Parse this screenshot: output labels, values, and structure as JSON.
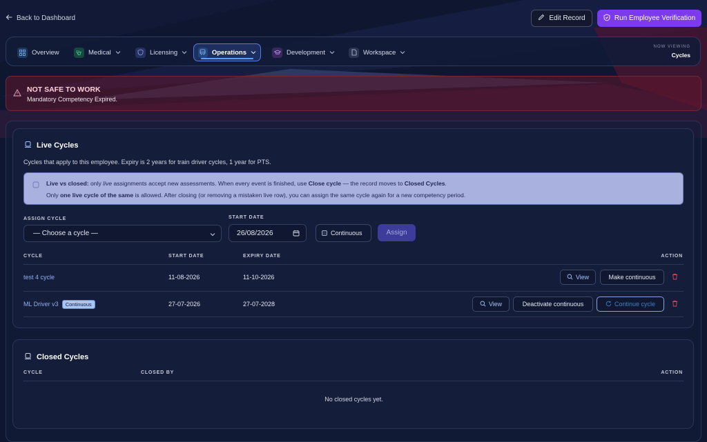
{
  "header": {
    "back_label": "Back to Dashboard",
    "edit_label": "Edit Record",
    "verify_label": "Run Employee Verification"
  },
  "nav": {
    "items": [
      {
        "label": "Overview",
        "icon": "grid-icon"
      },
      {
        "label": "Medical",
        "icon": "stethoscope-icon"
      },
      {
        "label": "Licensing",
        "icon": "shield-icon"
      },
      {
        "label": "Operations",
        "icon": "train-icon"
      },
      {
        "label": "Development",
        "icon": "graduation-cap-icon"
      },
      {
        "label": "Workspace",
        "icon": "file-icon"
      }
    ],
    "active": "Operations",
    "now_viewing_label": "NOW VIEWING",
    "now_viewing_value": "Cycles"
  },
  "alert": {
    "title": "NOT SAFE TO WORK",
    "message": "Mandatory Competency Expired."
  },
  "live": {
    "title": "Live Cycles",
    "description": "Cycles that apply to this employee. Expiry is 2 years for train driver cycles, 1 year for PTS.",
    "info_line1_parts": [
      "Live vs closed:",
      " only ",
      "live",
      " assignments accept new assessments. When every event is finished, use ",
      "Close cycle",
      " — the record moves to ",
      "Closed Cycles",
      "."
    ],
    "info_line2_parts": [
      "Only ",
      "one live cycle of the same",
      " is allowed. After closing (or removing a mistaken live row), you can assign the same cycle again for a new competency period."
    ],
    "assign_cycle_label": "ASSIGN CYCLE",
    "select_value": "— Choose a cycle —",
    "start_date_label": "START DATE",
    "start_date_value": "26/08/2026",
    "continuous_label": "Continuous",
    "assign_label": "Assign",
    "columns": [
      "CYCLE",
      "START DATE",
      "EXPIRY DATE",
      "ACTION"
    ],
    "rows": [
      {
        "cycle": "test 4 cycle",
        "badge": "",
        "start": "11-08-2026",
        "expiry": "11-10-2026",
        "actions": [
          "View",
          "Make continuous"
        ]
      },
      {
        "cycle": "ML Driver v3",
        "badge": "Continuous",
        "start": "27-07-2026",
        "expiry": "27-07-2028",
        "actions": [
          "View",
          "Deactivate continuous",
          "Continue cycle"
        ]
      }
    ]
  },
  "closed": {
    "title": "Closed Cycles",
    "columns": [
      "CYCLE",
      "CLOSED BY",
      "ACTION"
    ],
    "empty": "No closed cycles yet."
  },
  "colors": {
    "accent": "#7c3aed",
    "alert_bg": "#62162c",
    "link": "#93aef0",
    "danger": "#e0435b"
  }
}
